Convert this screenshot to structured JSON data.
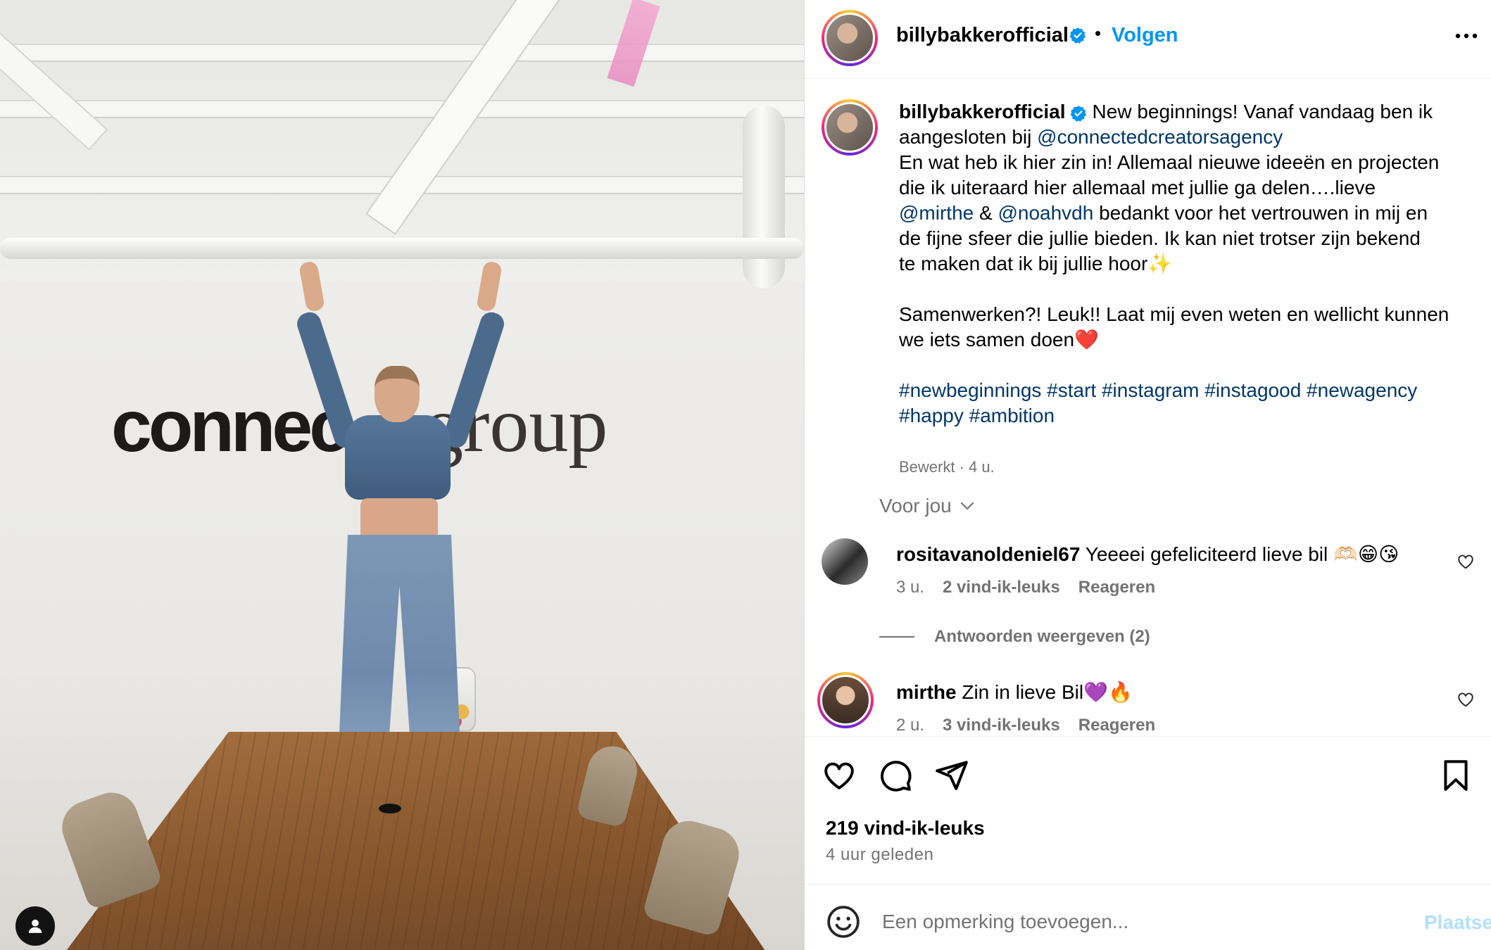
{
  "header": {
    "username": "billybakkerofficial",
    "separator": "•",
    "follow_label": "Volgen"
  },
  "photo": {
    "logo_sans": "connec",
    "logo_serif": "group"
  },
  "caption": {
    "username": "billybakkerofficial",
    "line1_a": "New beginnings! Vanaf vandaag ben ik",
    "line2_a": "aangesloten bij ",
    "mention_agency": "@connectedcreatorsagency",
    "line3": "En wat heb ik hier zin in! Allemaal nieuwe ideeën en projecten",
    "line4": "die ik uiteraard hier allemaal met jullie ga delen….lieve",
    "mention_mirthe": "@mirthe",
    "amp": " & ",
    "mention_noah": "@noahvdh",
    "line5_rest": " bedankt voor het vertrouwen in mij en",
    "line6": "de fijne sfeer die jullie bieden. Ik kan niet trotser zijn bekend",
    "line7": "te maken dat ik bij jullie hoor✨",
    "line8": "Samenwerken?! Leuk!! Laat mij even weten en wellicht kunnen",
    "line9": "we iets samen doen❤️",
    "hashtags_line1": "#newbeginnings #start #instagram #instagood #newagency",
    "hashtags_line2": "#happy #ambition",
    "meta": "Bewerkt · 4 u."
  },
  "voor_jou": "Voor jou",
  "comments": [
    {
      "username": "rositavanoldeniel67",
      "text": "Yeeeei gefeliciteerd lieve bil 🫶🏻😁😘",
      "time": "3 u.",
      "likes": "2 vind-ik-leuks",
      "reply": "Reageren"
    },
    {
      "username": "mirthe",
      "text": "Zin in lieve Bil💜🔥",
      "time": "2 u.",
      "likes": "3 vind-ik-leuks",
      "reply": "Reageren"
    }
  ],
  "view_replies": "Antwoorden weergeven (2)",
  "actions": {
    "likes": "219 vind-ik-leuks",
    "ago": "4 uur geleden"
  },
  "composer": {
    "placeholder": "Een opmerking toevoegen...",
    "post_label": "Plaatsen"
  },
  "colors": {
    "accent": "#0095f6",
    "link": "#00376b",
    "muted": "#737373",
    "post_disabled": "#b2dffc"
  }
}
